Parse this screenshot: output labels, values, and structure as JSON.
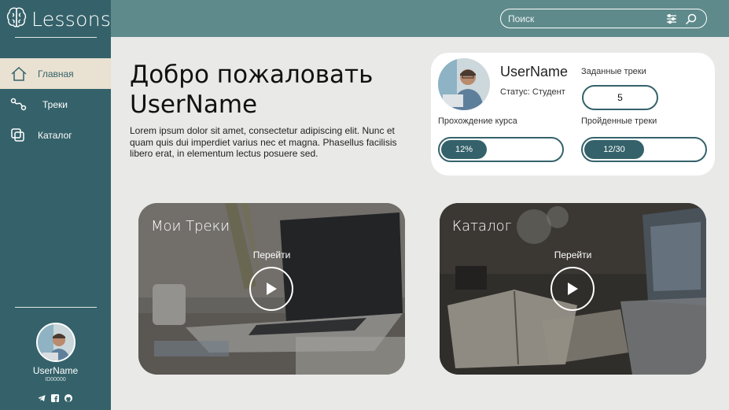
{
  "app": {
    "title": "Lessons"
  },
  "sidebar": {
    "items": [
      {
        "label": "Главная",
        "icon": "home-icon",
        "active": true
      },
      {
        "label": "Треки",
        "icon": "route-icon",
        "active": false
      },
      {
        "label": "Каталог",
        "icon": "catalog-icon",
        "active": false
      }
    ],
    "profile": {
      "name": "UserName",
      "id": "ID00000"
    },
    "socials": [
      "telegram-icon",
      "facebook-icon",
      "github-icon"
    ]
  },
  "header": {
    "search_placeholder": "Поиск"
  },
  "welcome": {
    "title_line1": "Добро пожаловать",
    "title_line2": "UserName",
    "text": "Lorem ipsum dolor sit amet, consectetur adipiscing elit. Nunc et quam quis dui imperdiet varius nec et magna. Phasellus facilisis libero erat, in elementum lectus posuere sed."
  },
  "profile_card": {
    "name": "UserName",
    "status": "Статус: Студент",
    "assigned_label": "Заданные треки",
    "assigned_value": "5",
    "progress_label": "Прохождение курса",
    "progress_text": "12%",
    "progress_fraction": 0.38,
    "completed_label": "Пройденные треки",
    "completed_text": "12/30",
    "completed_fraction": 0.5
  },
  "tiles": [
    {
      "title": "Мои Треки",
      "action": "Перейти"
    },
    {
      "title": "Каталог",
      "action": "Перейти"
    }
  ],
  "colors": {
    "sidebar": "#35626a",
    "header": "#5f8a8b",
    "active_nav": "#e9e1d1",
    "accent": "#35626a"
  }
}
